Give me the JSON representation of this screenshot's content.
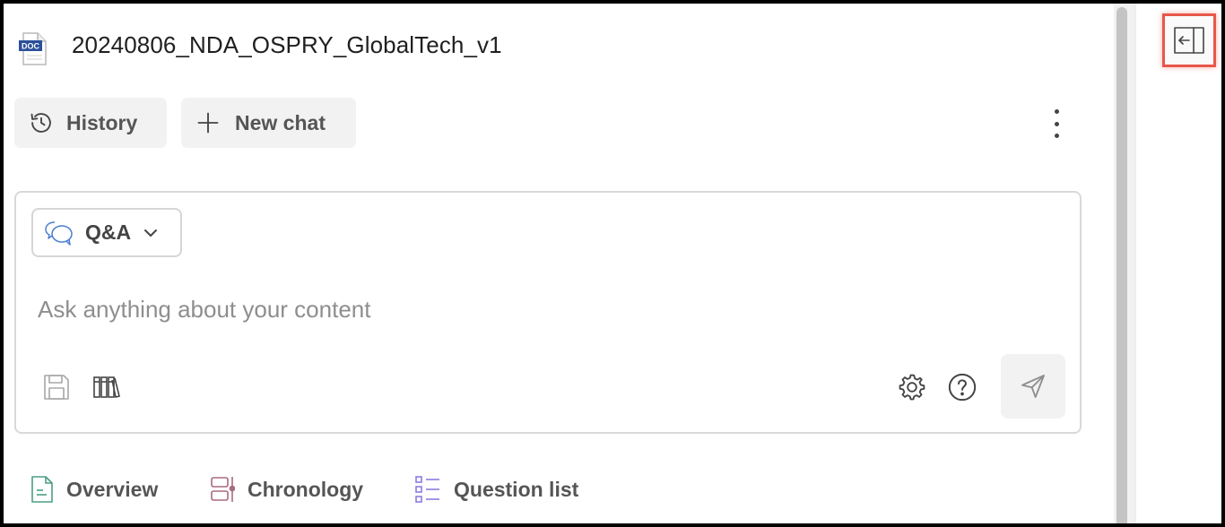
{
  "document": {
    "title": "20240806_NDA_OSPRY_GlobalTech_v1",
    "file_badge": "DOC"
  },
  "toolbar": {
    "history_label": "History",
    "new_chat_label": "New chat"
  },
  "chat": {
    "mode_label": "Q&A",
    "input_placeholder": "Ask anything about your content",
    "input_value": ""
  },
  "tabs": [
    {
      "label": "Overview",
      "icon": "document-lines-icon",
      "color": "#4a9e86"
    },
    {
      "label": "Chronology",
      "icon": "timeline-icon",
      "color": "#a86b7e"
    },
    {
      "label": "Question list",
      "icon": "list-icon",
      "color": "#8e7be0"
    }
  ],
  "colors": {
    "highlight": "#e8574a",
    "doc_badge": "#2b4f9b",
    "mode_icon": "#4a7fd0"
  },
  "icons": [
    "doc-file-icon",
    "history-icon",
    "plus-icon",
    "kebab-menu-icon",
    "chat-bubbles-icon",
    "chevron-down-icon",
    "save-icon",
    "library-icon",
    "gear-icon",
    "help-icon",
    "send-icon",
    "collapse-panel-icon"
  ]
}
